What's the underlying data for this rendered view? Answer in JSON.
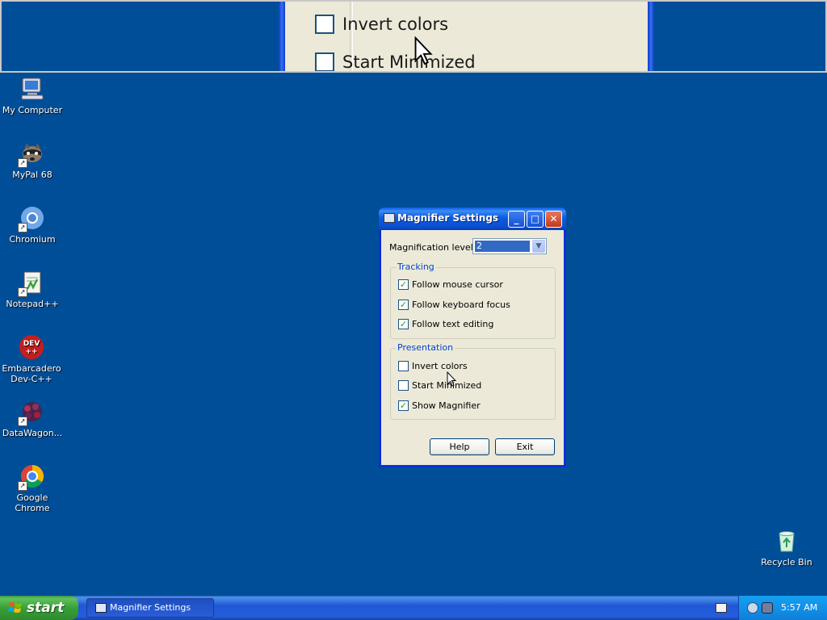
{
  "magnifier_view": {
    "items": [
      {
        "label": "Invert colors"
      },
      {
        "label": "Start Minimized"
      }
    ]
  },
  "desktop": {
    "icons": [
      {
        "label": "My Computer",
        "icon": "my-computer-icon"
      },
      {
        "label": "MyPal 68",
        "icon": "mypal-icon"
      },
      {
        "label": "Chromium",
        "icon": "chromium-icon"
      },
      {
        "label": "Notepad++",
        "icon": "notepad-plus-plus-icon"
      },
      {
        "label": "Embarcadero Dev-C++",
        "icon": "devcpp-icon",
        "icon_text": "DEV ++"
      },
      {
        "label": "DataWagon...",
        "icon": "datawagon-icon"
      },
      {
        "label": "Google Chrome",
        "icon": "google-chrome-icon"
      },
      {
        "label": "Recycle Bin",
        "icon": "recycle-bin-icon"
      }
    ]
  },
  "dialog": {
    "title": "Magnifier Settings",
    "magnification_label": "Magnification level:",
    "magnification_value": "2",
    "tracking": {
      "title": "Tracking",
      "items": [
        {
          "label": "Follow mouse cursor",
          "checked": true
        },
        {
          "label": "Follow keyboard focus",
          "checked": true
        },
        {
          "label": "Follow text editing",
          "checked": true
        }
      ]
    },
    "presentation": {
      "title": "Presentation",
      "items": [
        {
          "label": "Invert colors",
          "checked": false
        },
        {
          "label": "Start Minimized",
          "checked": false
        },
        {
          "label": "Show Magnifier",
          "checked": true
        }
      ]
    },
    "buttons": {
      "help": "Help",
      "exit": "Exit"
    }
  },
  "taskbar": {
    "start_label": "start",
    "task_item": "Magnifier Settings",
    "clock": "5:57 AM"
  },
  "colors": {
    "desktop": "#004e98",
    "titlebar": "#0a5ce8",
    "taskbar": "#245edb",
    "start_button": "#37a037",
    "checkmark": "#21a121"
  }
}
